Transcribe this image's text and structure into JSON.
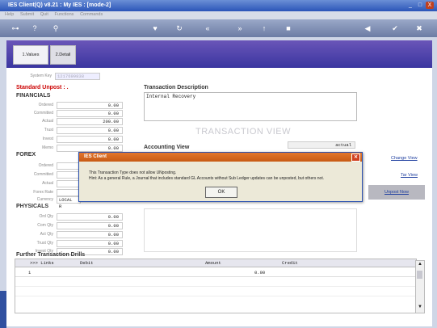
{
  "window": {
    "title": "IES Client(Q) v8.21 : My IES : [mode-2]",
    "controls": [
      "_",
      "□",
      "X"
    ]
  },
  "menu": {
    "items": [
      "Help",
      "Submit",
      "Quit",
      "Functions",
      "Commands"
    ]
  },
  "tabs": [
    {
      "label": "1.Values"
    },
    {
      "label": "2.Detail"
    }
  ],
  "form": {
    "system_key_label": "System Key",
    "system_key_value": "1217699838",
    "unpost_status": "Standard Unpost : .",
    "financials_header": "FINANCIALS",
    "financials": [
      {
        "label": "Ordered",
        "value": "0.00"
      },
      {
        "label": "Committed",
        "value": "0.00"
      },
      {
        "label": "Actual",
        "value": "200.00"
      },
      {
        "label": "Trust",
        "value": "0.00"
      },
      {
        "label": "Invest",
        "value": "0.00"
      },
      {
        "label": "Memo",
        "value": "0.00"
      }
    ],
    "forex_header": "FOREX",
    "forex": [
      {
        "label": "Ordered",
        "value": ""
      },
      {
        "label": "Committed",
        "value": ""
      },
      {
        "label": "Actual",
        "value": ""
      },
      {
        "label": "Forex Rate",
        "value": ""
      },
      {
        "label": "Currency",
        "value": "LOCAL R"
      }
    ],
    "physicals_header": "PHYSICALS",
    "physicals": [
      {
        "label": "Ord Qty",
        "value": "0.00"
      },
      {
        "label": "Com Qty",
        "value": "0.00"
      },
      {
        "label": "Act Qty",
        "value": "0.00"
      },
      {
        "label": "Trust Qty",
        "value": "0.00"
      },
      {
        "label": "Invest Qty",
        "value": "0.00"
      }
    ],
    "transaction_description_label": "Transaction Description",
    "transaction_description_value": "Internal Recovery",
    "watermark": "TRANSACTION VIEW",
    "accounting_view_label": "Accounting View",
    "accounting_view_value": "actual"
  },
  "side_actions": {
    "change_view": "Change View",
    "tar_view": "Tar View",
    "unpost_now": "Unpost Now"
  },
  "drills": {
    "header": "Further Transaction Drills",
    "columns": [
      ">>> Links",
      "Debit",
      "Amount",
      "Credit"
    ],
    "rows": [
      {
        "num": "1",
        "amount": "0.00"
      }
    ]
  },
  "dialog": {
    "title": "IES Client",
    "message_line1": "This Transaction Type does not allow UNposting.",
    "message_line2": "Hint: As a general Rule, a Journal that includes standard GL Accounts without Sub Ledger updates can be unposted, but others not.",
    "ok_label": "OK"
  },
  "colors": {
    "titlebar": "#2b55b8",
    "tabsbar": "#4a3aa8",
    "dialog_title": "#d4651e",
    "accent_red": "#cc0000",
    "link": "#2040a0"
  }
}
